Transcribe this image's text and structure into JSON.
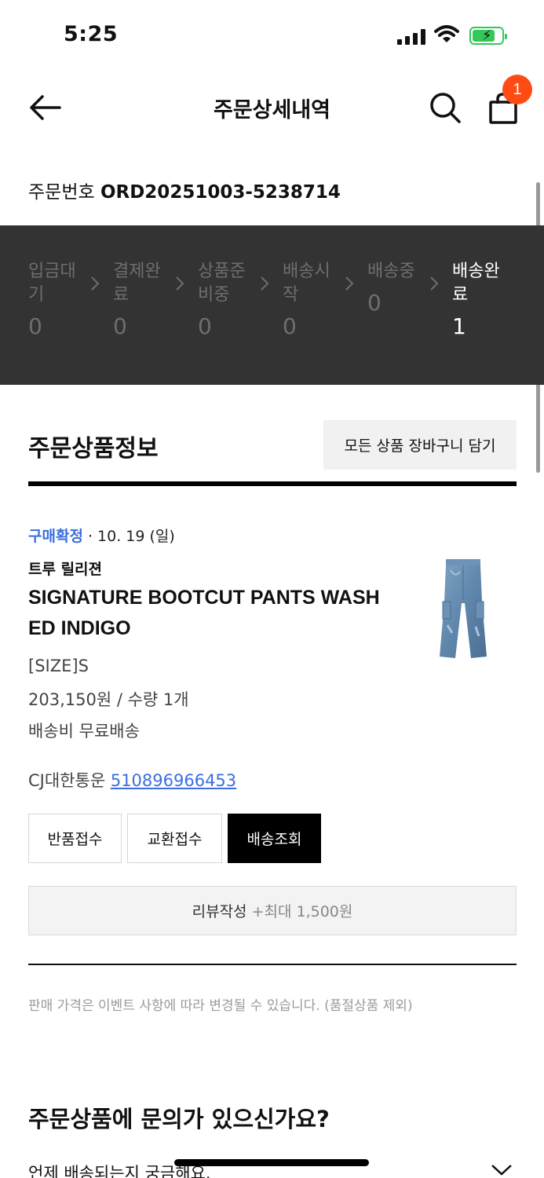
{
  "status_bar": {
    "time": "5:25"
  },
  "header": {
    "title": "주문상세내역",
    "cart_count": "1"
  },
  "order": {
    "label": "주문번호",
    "number": "ORD20251003-5238714"
  },
  "progress": {
    "steps": [
      {
        "label": "입금대\n기",
        "count": "0",
        "active": false
      },
      {
        "label": "결제완\n료",
        "count": "0",
        "active": false
      },
      {
        "label": "상품준\n비중",
        "count": "0",
        "active": false
      },
      {
        "label": "배송시\n작",
        "count": "0",
        "active": false
      },
      {
        "label": "배송중",
        "count": "0",
        "active": false
      },
      {
        "label": "배송완\n료",
        "count": "1",
        "active": true
      }
    ]
  },
  "section": {
    "title": "주문상품정보",
    "cart_all_label": "모든 상품 장바구니 담기"
  },
  "product": {
    "status": "구매확정",
    "separator": " · ",
    "date": "10. 19 (일)",
    "brand": "트루 릴리젼",
    "name": "SIGNATURE BOOTCUT PANTS WASHED INDIGO",
    "option": "[SIZE]S",
    "price_qty": "203,150원 / 수량 1개",
    "shipping": "배송비 무료배송",
    "courier": "CJ대한통운",
    "tracking_number": "510896966453"
  },
  "actions": {
    "return_label": "반품접수",
    "exchange_label": "교환접수",
    "track_label": "배송조회",
    "review_label": "리뷰작성",
    "review_bonus": "+최대 1,500원"
  },
  "notice": "판매 가격은 이벤트 사항에 따라 변경될 수 있습니다. (품절상품 제외)",
  "faq": {
    "title": "주문상품에 문의가 있으신가요?",
    "first_item": "언제 배송되는지 궁금해요."
  },
  "colors": {
    "accent_blue": "#3b6ee0",
    "badge": "#ff4b14",
    "panel": "#333333"
  }
}
